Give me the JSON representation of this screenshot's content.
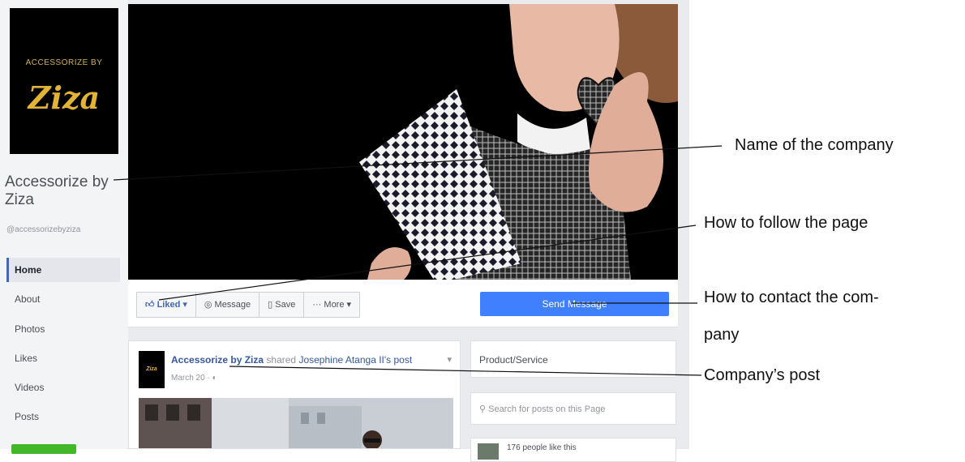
{
  "sidebar": {
    "logo_small": "ACCESSORIZE BY",
    "logo_big": "Ziza",
    "page_name": "Accessorize by Ziza",
    "page_handle": "@accessorizebyziza",
    "nav": [
      "Home",
      "About",
      "Photos",
      "Likes",
      "Videos",
      "Posts"
    ]
  },
  "actions": {
    "liked": "Liked ▾",
    "message": "Message",
    "save": "Save",
    "more": "More ▾",
    "send_message": "Send Message"
  },
  "post": {
    "avatar_text": "Ziza",
    "author": "Accessorize by Ziza",
    "shared_text": "shared",
    "shared_link": "Josephine Atanga II's post",
    "date": "March 20 · ",
    "chevron": "▾"
  },
  "right_col": {
    "category": "Product/Service",
    "search_placeholder": "Search for posts on this Page",
    "likes_count": "176 people like this"
  },
  "annotations": {
    "name": "Name of the company",
    "follow": "How to  follow the page",
    "contact_line1": "How to contact the com-",
    "contact_line2": "pany",
    "post": "Company’s post"
  },
  "icons": [
    "thumbs-up-icon",
    "message-icon",
    "bookmark-icon",
    "search-icon",
    "globe-icon"
  ],
  "colors": {
    "facebook_blue": "#4080ff",
    "link_blue": "#365899",
    "logo_gold": "#e2b335",
    "page_bg": "#e9ebee"
  }
}
